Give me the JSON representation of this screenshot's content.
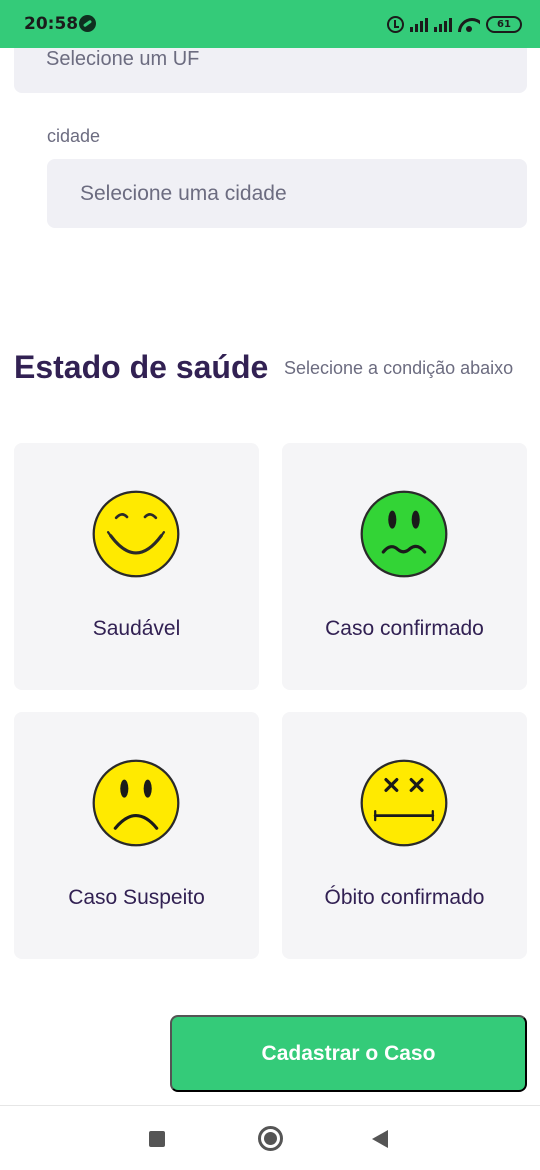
{
  "status_bar": {
    "time": "20:58",
    "battery": "61"
  },
  "form": {
    "uf_placeholder": "Selecione um UF",
    "city_label": "cidade",
    "city_placeholder": "Selecione uma cidade"
  },
  "health_section": {
    "title": "Estado de saúde",
    "subtitle": "Selecione a condição abaixo",
    "options": [
      {
        "label": "Saudável",
        "icon": "happy-face-icon",
        "color": "#ffea00"
      },
      {
        "label": "Caso confirmado",
        "icon": "sick-face-icon",
        "color": "#33d436"
      },
      {
        "label": "Caso Suspeito",
        "icon": "sad-face-icon",
        "color": "#ffea00"
      },
      {
        "label": "Óbito confirmado",
        "icon": "dead-face-icon",
        "color": "#ffea00"
      }
    ]
  },
  "submit_label": "Cadastrar o Caso",
  "colors": {
    "primary": "#34cb79",
    "title": "#322153",
    "muted": "#6c6c80",
    "field_bg": "#f0f0f5",
    "card_bg": "#f5f5f7"
  }
}
